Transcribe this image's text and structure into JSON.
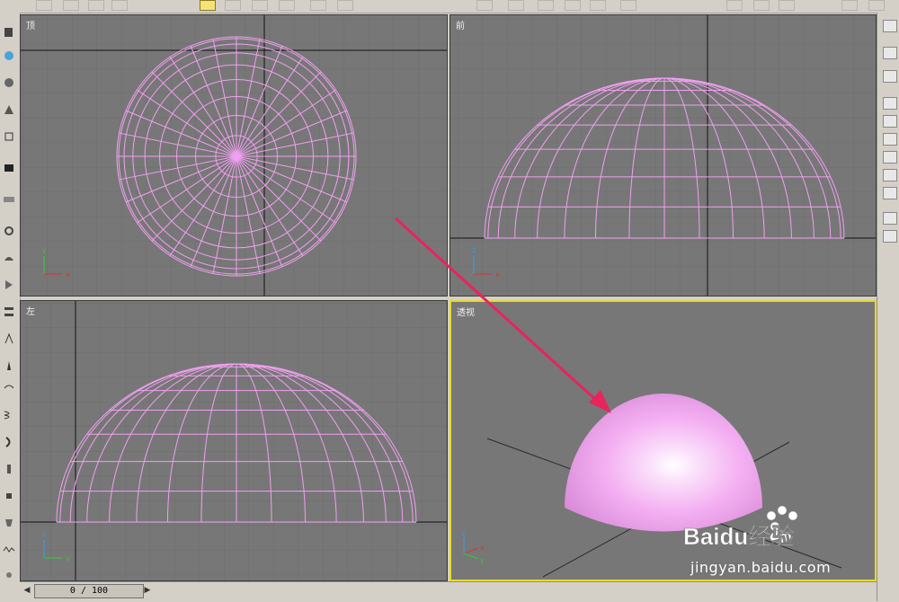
{
  "viewports": {
    "top": {
      "label": "顶"
    },
    "front": {
      "label": "前"
    },
    "left": {
      "label": "左"
    },
    "perspective": {
      "label": "透视"
    }
  },
  "axis": {
    "x": "x",
    "y": "y",
    "z": "z"
  },
  "timeline": {
    "frame_display": "0 / 100",
    "prev_icon": "chevron-left-icon",
    "next_icon": "chevron-right-icon"
  },
  "colors": {
    "viewport_bg": "#777777",
    "wireframe": "#f0a0f0",
    "active_viewport_border": "#e9d92a",
    "arrow": "#e8245c",
    "hemisphere": "#f4b0f2"
  },
  "watermark": {
    "logo_text": "Baidu经验",
    "url": "jingyan.baidu.com"
  }
}
